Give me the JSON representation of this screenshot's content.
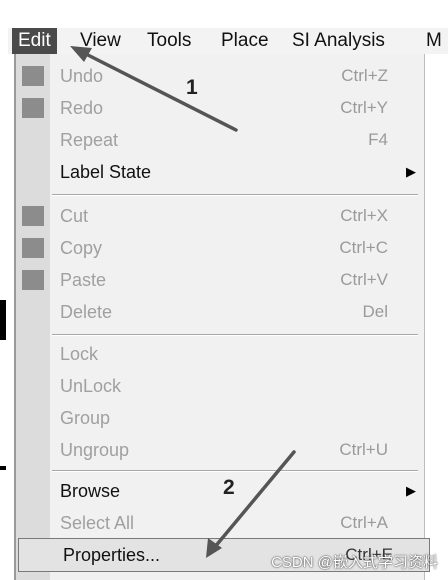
{
  "menubar": {
    "items": [
      "Edit",
      "View",
      "Tools",
      "Place",
      "SI Analysis",
      "M"
    ]
  },
  "menu": {
    "undo": {
      "label": "Undo",
      "shortcut": "Ctrl+Z"
    },
    "redo": {
      "label": "Redo",
      "shortcut": "Ctrl+Y"
    },
    "repeat": {
      "label": "Repeat",
      "shortcut": "F4"
    },
    "label_state": {
      "label": "Label State"
    },
    "cut": {
      "label": "Cut",
      "shortcut": "Ctrl+X"
    },
    "copy": {
      "label": "Copy",
      "shortcut": "Ctrl+C"
    },
    "paste": {
      "label": "Paste",
      "shortcut": "Ctrl+V"
    },
    "delete": {
      "label": "Delete",
      "shortcut": "Del"
    },
    "lock": {
      "label": "Lock"
    },
    "unlock": {
      "label": "UnLock"
    },
    "group": {
      "label": "Group"
    },
    "ungroup": {
      "label": "Ungroup",
      "shortcut": "Ctrl+U"
    },
    "browse": {
      "label": "Browse"
    },
    "select_all": {
      "label": "Select All",
      "shortcut": "Ctrl+A"
    },
    "properties": {
      "label": "Properties...",
      "shortcut": "Ctrl+E"
    }
  },
  "annotations": {
    "step1": "1",
    "step2": "2"
  },
  "watermark": "CSDN @嵌入式学习资料"
}
